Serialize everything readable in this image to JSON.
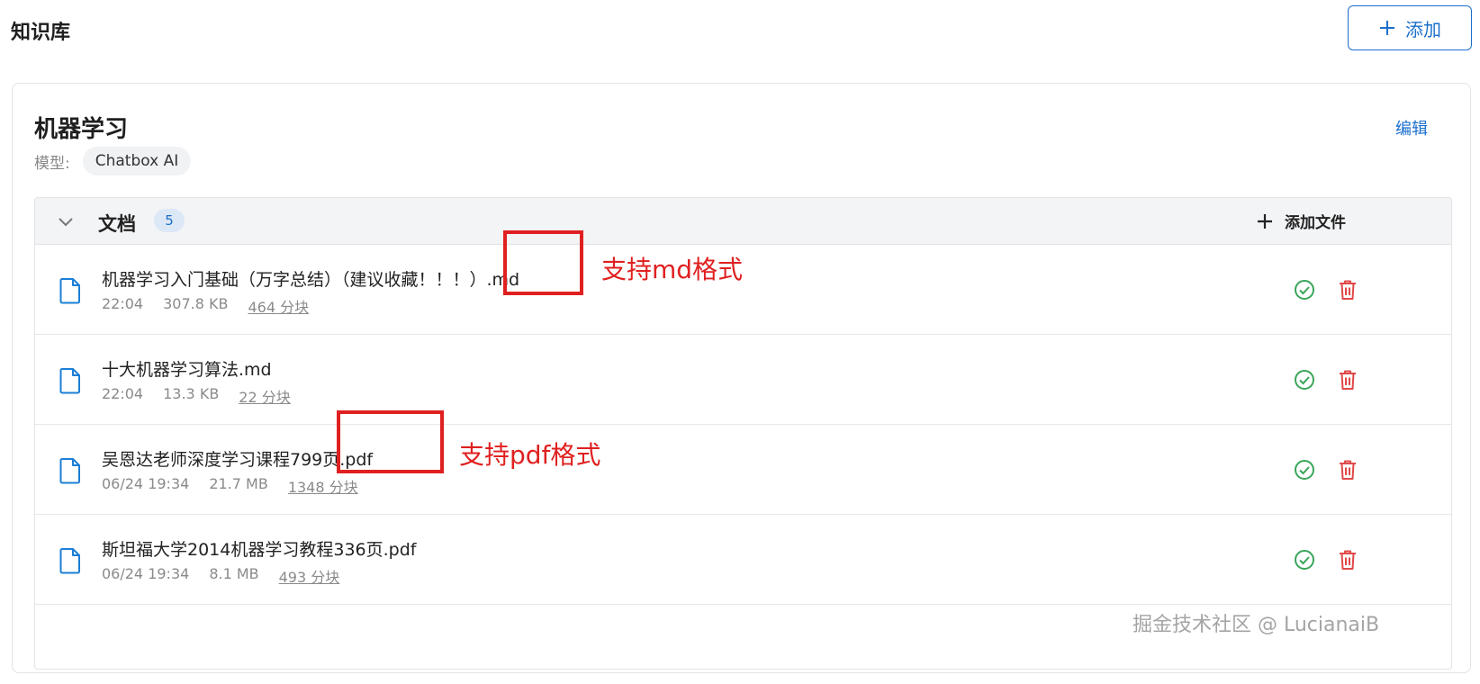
{
  "header": {
    "title": "知识库",
    "add_label": "添加"
  },
  "knowledge_base": {
    "name": "机器学习",
    "edit_label": "编辑",
    "model_label": "模型:",
    "model_value": "Chatbox AI"
  },
  "documents": {
    "section_title": "文档",
    "count": "5",
    "add_file_label": "添加文件",
    "items": [
      {
        "name": "机器学习入门基础（万字总结）（建议收藏！！！）.md",
        "time": "22:04",
        "size": "307.8 KB",
        "chunks": "464 分块"
      },
      {
        "name": "十大机器学习算法.md",
        "time": "22:04",
        "size": "13.3 KB",
        "chunks": "22 分块"
      },
      {
        "name": "吴恩达老师深度学习课程799页.pdf",
        "time": "06/24 19:34",
        "size": "21.7 MB",
        "chunks": "1348 分块"
      },
      {
        "name": "斯坦福大学2014机器学习教程336页.pdf",
        "time": "06/24 19:34",
        "size": "8.1 MB",
        "chunks": "493 分块"
      }
    ]
  },
  "annotations": {
    "md_note": "支持md格式",
    "pdf_note": "支持pdf格式"
  },
  "watermark": "掘金技术社区 @ LucianaiB",
  "colors": {
    "accent": "#1b6fcc",
    "success": "#3aa55a",
    "danger": "#e04848",
    "annotation": "#e02020"
  },
  "icons": {
    "add": "plus-icon",
    "collapse": "chevron-down-icon",
    "file": "file-icon",
    "status": "check-circle-icon",
    "delete": "trash-icon"
  }
}
